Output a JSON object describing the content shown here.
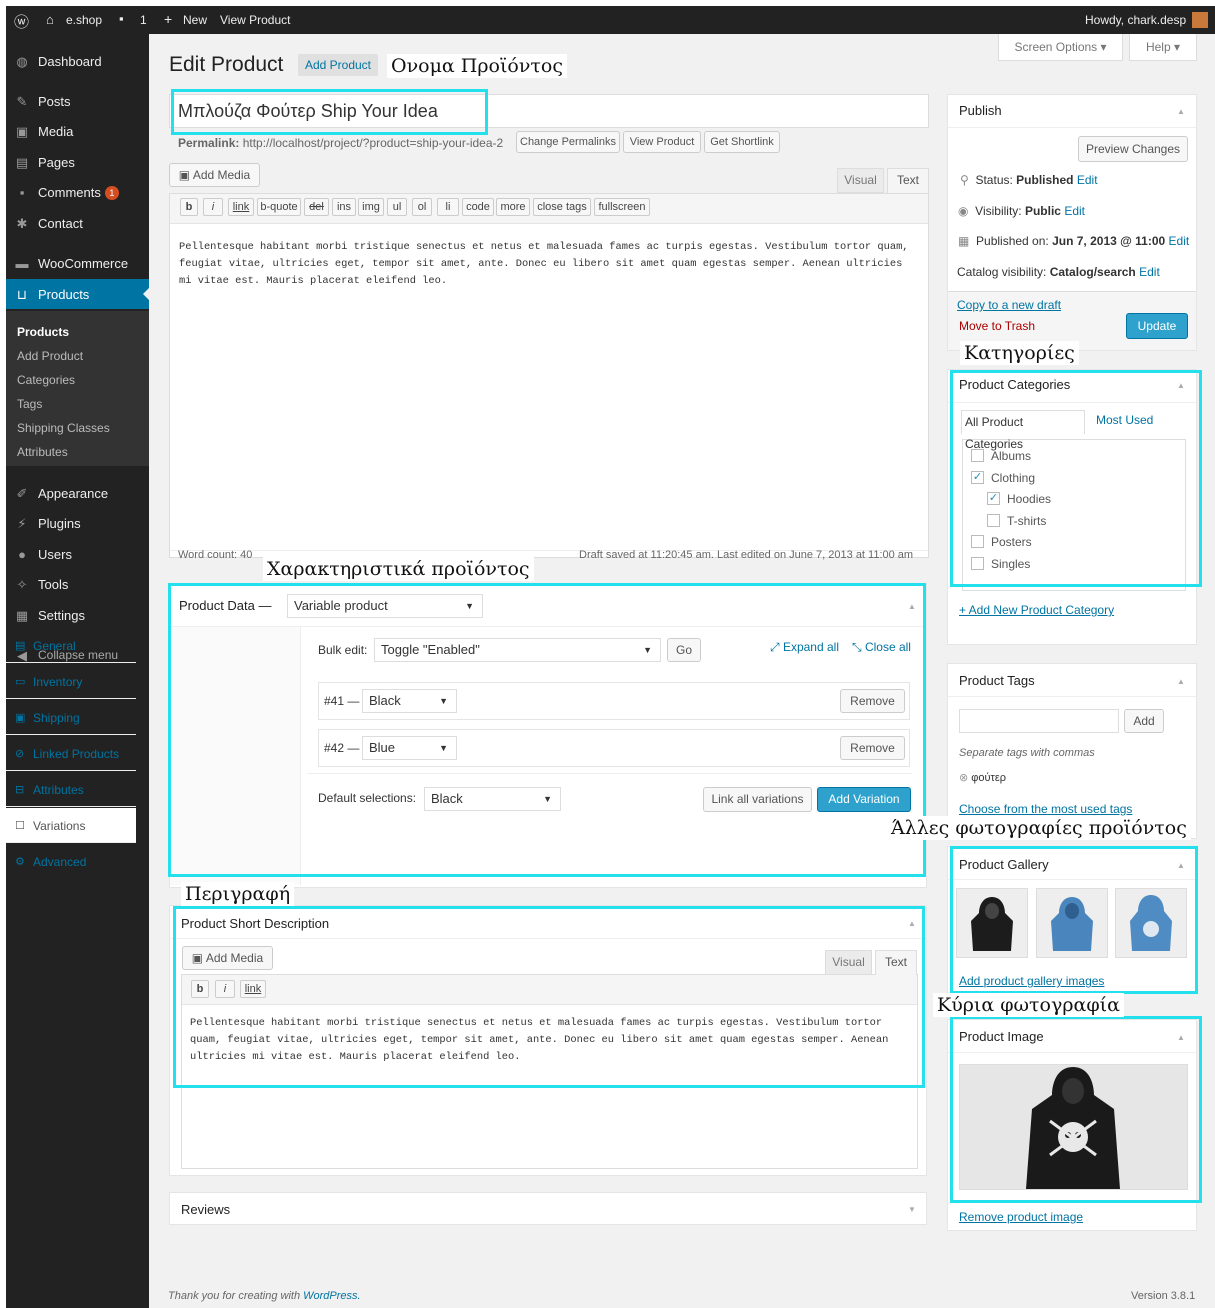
{
  "adminbar": {
    "site": "e.shop",
    "comments_count": "1",
    "new_label": "New",
    "view_product": "View Product",
    "howdy": "Howdy, chark.desp"
  },
  "menu": {
    "items": [
      "Dashboard",
      "Posts",
      "Media",
      "Pages",
      "Comments",
      "Contact",
      "WooCommerce",
      "Products",
      "Appearance",
      "Plugins",
      "Users",
      "Tools",
      "Settings"
    ],
    "comments_badge": "1",
    "submenu": [
      "Products",
      "Add Product",
      "Categories",
      "Tags",
      "Shipping Classes",
      "Attributes"
    ],
    "collapse": "Collapse menu"
  },
  "header": {
    "title": "Edit Product",
    "add_button": "Add Product",
    "screen_options": "Screen Options",
    "help": "Help"
  },
  "product": {
    "title": "Μπλούζα Φούτερ Ship Your Idea",
    "permalink_label": "Permalink:",
    "permalink_url": "http://localhost/project/?product=ship-your-idea-2",
    "change_permalinks": "Change Permalinks",
    "view_product": "View Product",
    "get_shortlink": "Get Shortlink"
  },
  "editor": {
    "add_media": "Add Media",
    "visual": "Visual",
    "text": "Text",
    "quicktags": [
      "b",
      "i",
      "link",
      "b-quote",
      "del",
      "ins",
      "img",
      "ul",
      "ol",
      "li",
      "code",
      "more",
      "close tags",
      "fullscreen"
    ],
    "content": "Pellentesque habitant morbi tristique senectus et netus et malesuada fames ac turpis egestas. Vestibulum tortor quam, feugiat vitae, ultricies eget, tempor sit amet, ante. Donec eu libero sit amet quam egestas semper. Aenean ultricies mi vitae est. Mauris placerat eleifend leo.",
    "word_count": "Word count: 40",
    "draft_saved": "Draft saved at 11:20:45 am. Last edited on June 7, 2013 at 11:00 am"
  },
  "product_data": {
    "label": "Product Data —",
    "type": "Variable product",
    "tabs": [
      "General",
      "Inventory",
      "Shipping",
      "Linked Products",
      "Attributes",
      "Variations",
      "Advanced"
    ],
    "bulk_label": "Bulk edit:",
    "bulk_value": "Toggle \"Enabled\"",
    "go": "Go",
    "expand_all": "Expand all",
    "close_all": "Close all",
    "variations": [
      {
        "id": "#41 —",
        "value": "Black",
        "remove": "Remove"
      },
      {
        "id": "#42 —",
        "value": "Blue",
        "remove": "Remove"
      }
    ],
    "default_label": "Default selections:",
    "default_value": "Black",
    "link_all": "Link all variations",
    "add_variation": "Add Variation"
  },
  "short_desc": {
    "title": "Product Short Description",
    "add_media": "Add Media",
    "visual": "Visual",
    "text": "Text",
    "quicktags": [
      "b",
      "i",
      "link"
    ],
    "content": "Pellentesque habitant morbi tristique senectus et netus et malesuada fames ac turpis egestas. Vestibulum tortor quam, feugiat vitae, ultricies eget, tempor sit amet, ante. Donec eu libero sit amet quam egestas semper. Aenean ultricies mi vitae est. Mauris placerat eleifend leo."
  },
  "reviews": {
    "title": "Reviews"
  },
  "publish": {
    "title": "Publish",
    "preview": "Preview Changes",
    "status_label": "Status:",
    "status": "Published",
    "visibility_label": "Visibility:",
    "visibility": "Public",
    "published_label": "Published on:",
    "published": "Jun 7, 2013 @ 11:00",
    "catalog_label": "Catalog visibility:",
    "catalog": "Catalog/search",
    "edit": "Edit",
    "copy": "Copy to a new draft",
    "trash": "Move to Trash",
    "update": "Update"
  },
  "categories": {
    "title": "Product Categories",
    "tab_all": "All Product Categories",
    "tab_most": "Most Used",
    "items": [
      {
        "name": "Albums",
        "checked": false
      },
      {
        "name": "Clothing",
        "checked": true
      },
      {
        "name": "Hoodies",
        "checked": true
      },
      {
        "name": "T-shirts",
        "checked": false
      },
      {
        "name": "Posters",
        "checked": false
      },
      {
        "name": "Singles",
        "checked": false
      }
    ],
    "add_new": "+ Add New Product Category"
  },
  "tags": {
    "title": "Product Tags",
    "add": "Add",
    "hint": "Separate tags with commas",
    "tag": "φούτερ",
    "choose": "Choose from the most used tags"
  },
  "gallery": {
    "title": "Product Gallery",
    "add": "Add product gallery images"
  },
  "image": {
    "title": "Product Image",
    "remove": "Remove product image"
  },
  "annotations": {
    "name": "Ονομα Προϊόντος",
    "features": "Χαρακτηριστικά προϊόντος",
    "description": "Περιγραφή",
    "categories": "Κατηγορίες",
    "other_photos": "Άλλες φωτογραφίες προϊόντος",
    "main_photo": "Κύρια φωτογραφία"
  },
  "footer": {
    "thanks": "Thank you for creating with",
    "wp": "WordPress.",
    "version": "Version 3.8.1"
  },
  "colors": {
    "accent": "#0074a2",
    "update": "#2ea2cc",
    "highlight": "#23e0ec",
    "adminbar": "#222222"
  }
}
